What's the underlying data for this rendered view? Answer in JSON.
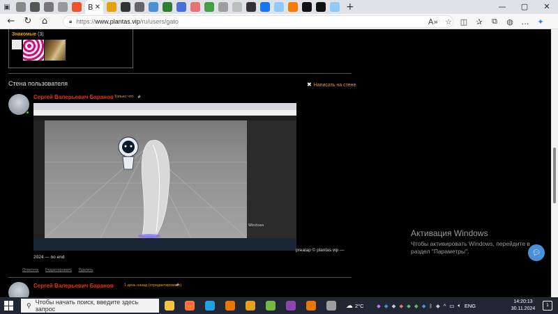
{
  "browser": {
    "tabs": [
      {
        "icon": "tab-favicon-1",
        "color": "#888888"
      },
      {
        "icon": "tab-favicon-2",
        "color": "#555555"
      },
      {
        "icon": "tab-favicon-3",
        "color": "#777777"
      },
      {
        "icon": "tab-favicon-4",
        "color": "#999999"
      },
      {
        "icon": "tab-favicon-5",
        "color": "#e8542c"
      },
      {
        "icon": "tab-favicon-6",
        "color": "#e8a300"
      },
      {
        "icon": "tab-favicon-7",
        "color": "#333333"
      },
      {
        "icon": "tab-favicon-8",
        "color": "#666666"
      },
      {
        "icon": "tab-favicon-9",
        "color": "#4d8fd6"
      },
      {
        "icon": "tab-favicon-10",
        "color": "#2e7d32"
      },
      {
        "icon": "tab-favicon-11",
        "color": "#4b6fd9"
      },
      {
        "icon": "tab-favicon-12",
        "color": "#e57373"
      },
      {
        "icon": "tab-favicon-13",
        "color": "#43a047"
      },
      {
        "icon": "tab-favicon-14",
        "color": "#9e9e9e"
      },
      {
        "icon": "tab-favicon-15",
        "color": "#bdbdbd"
      },
      {
        "icon": "tab-favicon-16",
        "color": "#333333"
      },
      {
        "icon": "tab-favicon-17",
        "color": "#1877f2"
      },
      {
        "icon": "tab-favicon-18",
        "color": "#90caf9"
      },
      {
        "icon": "tab-favicon-19",
        "color": "#f57c00"
      },
      {
        "icon": "tab-favicon-20",
        "color": "#111111"
      },
      {
        "icon": "tab-favicon-21",
        "color": "#111111"
      },
      {
        "icon": "tab-favicon-22",
        "color": "#90caf9"
      }
    ],
    "active_tab_label": "B",
    "url_scheme": "https://",
    "url_host": "www.plantas.vip",
    "url_path": "/ru/users/gato"
  },
  "friends": {
    "title": "Знакомые",
    "count": "(3)"
  },
  "wall": {
    "title": "Стена пользователя",
    "write_link": "Написать на стене"
  },
  "posts": [
    {
      "author": "Сергей Валерьевич Баранов",
      "time": "Только что",
      "hash": "#",
      "caption_right": "prealap © plantas.vip —",
      "caption_line2": "2024 — no end",
      "actions": [
        "Ответить",
        "Редактировать",
        "Удалить"
      ]
    },
    {
      "author": "Сергей Валерьевич Баранов",
      "time": "1 день назад (отредактировано)",
      "hash": "#"
    }
  ],
  "screenshot_inner": {
    "windows_label": "Windows"
  },
  "windows_activation": {
    "title": "Активация Windows",
    "subtitle": "Чтобы активировать Windows, перейдите в раздел \"Параметры\"."
  },
  "taskbar": {
    "search_placeholder": "Чтобы начать поиск, введите здесь запрос",
    "weather": "2°C",
    "lang": "ENG",
    "time": "14:20:13",
    "date": "30.11.2024",
    "notification_count": "1",
    "apps": [
      {
        "name": "file-explorer-icon",
        "color": "#f4c542"
      },
      {
        "name": "firefox-icon",
        "color": "#ff7139"
      },
      {
        "name": "edge-icon",
        "color": "#1fa0e3"
      },
      {
        "name": "blender-icon",
        "color": "#ea7600"
      },
      {
        "name": "app-orange-icon",
        "color": "#e3a21a"
      },
      {
        "name": "utorrent-icon",
        "color": "#76b83f"
      },
      {
        "name": "app-purple-icon",
        "color": "#8e44ad"
      },
      {
        "name": "blender-icon-2",
        "color": "#ea7600"
      },
      {
        "name": "app-gray-icon",
        "color": "#9e9e9e"
      }
    ]
  }
}
